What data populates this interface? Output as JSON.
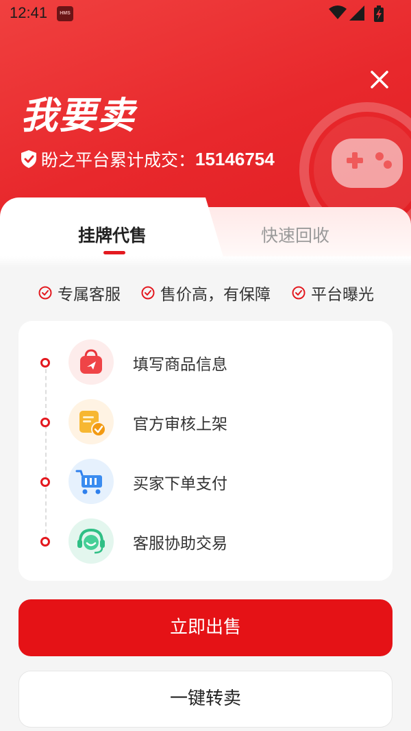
{
  "status_bar": {
    "time": "12:41",
    "hms_badge": "HMS",
    "icons": [
      "wifi-icon",
      "signal-icon",
      "battery-charging-icon"
    ]
  },
  "header": {
    "title": "我要卖",
    "stats_label": "盼之平台累计成交：",
    "stats_value": "15146754",
    "close_icon": "close-icon",
    "decor_icon": "gamepad-icon"
  },
  "tabs": [
    {
      "label": "挂牌代售",
      "active": true
    },
    {
      "label": "快速回收",
      "active": false
    }
  ],
  "features": [
    {
      "icon": "check-circle-icon",
      "label": "专属客服"
    },
    {
      "icon": "check-circle-icon",
      "label": "售价高，有保障"
    },
    {
      "icon": "check-circle-icon",
      "label": "平台曝光"
    }
  ],
  "steps": [
    {
      "icon": "shopping-bag-icon",
      "label": "填写商品信息"
    },
    {
      "icon": "document-check-icon",
      "label": "官方审核上架"
    },
    {
      "icon": "shopping-cart-icon",
      "label": "买家下单支付"
    },
    {
      "icon": "headset-support-icon",
      "label": "客服协助交易"
    }
  ],
  "actions": {
    "primary": "立即出售",
    "secondary": "一键转卖"
  },
  "colors": {
    "brand_red": "#e51216",
    "accent_red": "#e3191f",
    "hero_gradient_start": "#f0403f",
    "hero_gradient_end": "#e21f24"
  }
}
